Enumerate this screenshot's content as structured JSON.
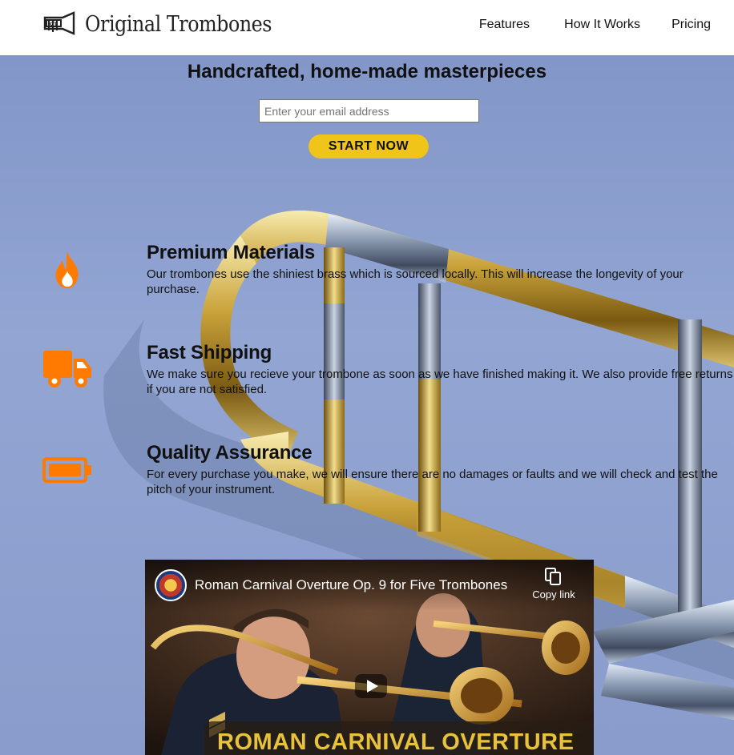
{
  "brand": {
    "name": "Original Trombones",
    "logo_icon": "trombone-logo-icon"
  },
  "nav": {
    "items": [
      {
        "label": "Features"
      },
      {
        "label": "How It Works"
      },
      {
        "label": "Pricing"
      }
    ]
  },
  "hero": {
    "title": "Handcrafted, home-made masterpieces",
    "email_placeholder": "Enter your email address",
    "cta_label": "START NOW"
  },
  "features": [
    {
      "icon": "fire-icon",
      "title": "Premium Materials",
      "text": "Our trombones use the shiniest brass which is sourced locally. This will increase the longevity of your purchase."
    },
    {
      "icon": "truck-icon",
      "title": "Fast Shipping",
      "text": "We make sure you recieve your trombone as soon as we have finished making it. We also provide free returns if you are not satisfied."
    },
    {
      "icon": "battery-icon",
      "title": "Quality Assurance",
      "text": "For every purchase you make, we will ensure there are no damages or faults and we will check and test the pitch of your instrument."
    }
  ],
  "video": {
    "title": "Roman Carnival Overture Op. 9 for Five Trombones",
    "copy_link_label": "Copy link",
    "caption": "ROMAN CARNIVAL OVERTURE"
  },
  "colors": {
    "accent_orange": "#ff7a00",
    "cta_yellow": "#f0c419",
    "page_blue": "#8c9fcd",
    "caption_gold": "#e9c23b"
  }
}
